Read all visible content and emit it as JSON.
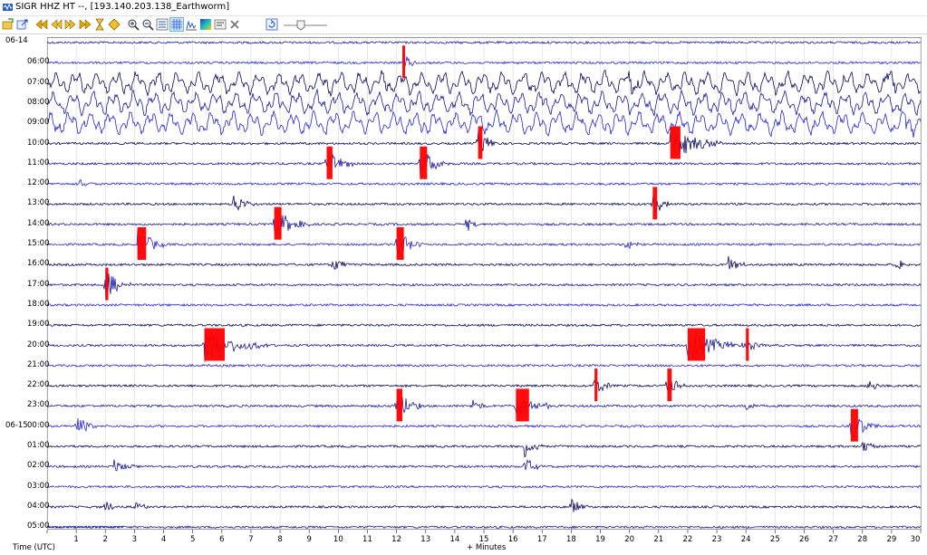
{
  "window": {
    "title": "SIGR HHZ HT --, [193.140.203.138_Earthworm]"
  },
  "toolbar": {
    "icons": [
      "open-file-icon",
      "rewind-icon",
      "step-back-icon",
      "step-forward-icon",
      "fast-forward-icon",
      "hourglass-icon",
      "event-marker-icon",
      "zoom-in-icon",
      "zoom-out-icon",
      "filter-icon",
      "grid-view-icon",
      "spectrum-icon",
      "color-scale-icon",
      "settings-icon",
      "close-icon",
      "refresh-icon",
      "zoom-slider"
    ]
  },
  "helicorder": {
    "row_labels": [
      {
        "date": "06-14",
        "time": ""
      },
      {
        "date": "",
        "time": "06:00"
      },
      {
        "date": "",
        "time": "07:00"
      },
      {
        "date": "",
        "time": "08:00"
      },
      {
        "date": "",
        "time": "09:00"
      },
      {
        "date": "",
        "time": "10:00"
      },
      {
        "date": "",
        "time": "11:00"
      },
      {
        "date": "",
        "time": "12:00"
      },
      {
        "date": "",
        "time": "13:00"
      },
      {
        "date": "",
        "time": "14:00"
      },
      {
        "date": "",
        "time": "15:00"
      },
      {
        "date": "",
        "time": "16:00"
      },
      {
        "date": "",
        "time": "17:00"
      },
      {
        "date": "",
        "time": "18:00"
      },
      {
        "date": "",
        "time": "19:00"
      },
      {
        "date": "",
        "time": "20:00"
      },
      {
        "date": "",
        "time": "21:00"
      },
      {
        "date": "",
        "time": "22:00"
      },
      {
        "date": "",
        "time": "23:00"
      },
      {
        "date": "06-15",
        "time": "00:00"
      },
      {
        "date": "",
        "time": "01:00"
      },
      {
        "date": "",
        "time": "02:00"
      },
      {
        "date": "",
        "time": "03:00"
      },
      {
        "date": "",
        "time": "04:00"
      },
      {
        "date": "",
        "time": "05:00"
      }
    ],
    "x_ticks": [
      "1",
      "2",
      "3",
      "4",
      "5",
      "6",
      "7",
      "8",
      "9",
      "10",
      "11",
      "12",
      "13",
      "14",
      "15",
      "16",
      "17",
      "18",
      "19",
      "20",
      "21",
      "22",
      "23",
      "24",
      "25",
      "26",
      "27",
      "28",
      "29",
      "30"
    ],
    "x_axis_label": "+ Minutes",
    "y_axis_label": "Time (UTC)",
    "x_range": [
      0,
      30
    ],
    "trace_colors": [
      "#1a1a9c",
      "#2626d6",
      "#0a0a5c"
    ],
    "event_color": "#ff0000",
    "gridline_color": "#d8d8d8",
    "events": [
      {
        "row": 5,
        "minute": 14.8,
        "amp": 16,
        "dur": 0.8,
        "mark": 0.15
      },
      {
        "row": 5,
        "minute": 21.4,
        "amp": 20,
        "dur": 1.8,
        "mark": 0.35
      },
      {
        "row": 6,
        "minute": 9.6,
        "amp": 18,
        "dur": 0.9,
        "mark": 0.2
      },
      {
        "row": 6,
        "minute": 12.8,
        "amp": 18,
        "dur": 1.0,
        "mark": 0.25
      },
      {
        "row": 7,
        "minute": 1.1,
        "amp": 7,
        "dur": 0.5,
        "mark": 0
      },
      {
        "row": 8,
        "minute": 6.4,
        "amp": 12,
        "dur": 0.8,
        "mark": 0
      },
      {
        "row": 8,
        "minute": 20.8,
        "amp": 16,
        "dur": 0.6,
        "mark": 0.15
      },
      {
        "row": 9,
        "minute": 7.8,
        "amp": 18,
        "dur": 1.2,
        "mark": 0.25
      },
      {
        "row": 9,
        "minute": 14.4,
        "amp": 10,
        "dur": 0.4,
        "mark": 0
      },
      {
        "row": 10,
        "minute": 3.1,
        "amp": 18,
        "dur": 1.0,
        "mark": 0.3
      },
      {
        "row": 10,
        "minute": 12.0,
        "amp": 18,
        "dur": 0.9,
        "mark": 0.25
      },
      {
        "row": 10,
        "minute": 19.9,
        "amp": 8,
        "dur": 0.5,
        "mark": 0
      },
      {
        "row": 11,
        "minute": 9.8,
        "amp": 10,
        "dur": 0.6,
        "mark": 0
      },
      {
        "row": 11,
        "minute": 23.4,
        "amp": 10,
        "dur": 0.6,
        "mark": 0
      },
      {
        "row": 11,
        "minute": 29.2,
        "amp": 8,
        "dur": 0.5,
        "mark": 0
      },
      {
        "row": 12,
        "minute": 2.0,
        "amp": 18,
        "dur": 0.9,
        "mark": 0.1
      },
      {
        "row": 15,
        "minute": 5.4,
        "amp": 18,
        "dur": 2.2,
        "mark": 0.7
      },
      {
        "row": 15,
        "minute": 22.0,
        "amp": 18,
        "dur": 2.0,
        "mark": 0.6
      },
      {
        "row": 15,
        "minute": 24.0,
        "amp": 12,
        "dur": 0.6,
        "mark": 0.1
      },
      {
        "row": 17,
        "minute": 18.8,
        "amp": 14,
        "dur": 0.6,
        "mark": 0.1
      },
      {
        "row": 17,
        "minute": 21.3,
        "amp": 14,
        "dur": 0.6,
        "mark": 0.15
      },
      {
        "row": 17,
        "minute": 28.2,
        "amp": 8,
        "dur": 0.6,
        "mark": 0
      },
      {
        "row": 18,
        "minute": 12.0,
        "amp": 18,
        "dur": 0.9,
        "mark": 0.2
      },
      {
        "row": 18,
        "minute": 16.1,
        "amp": 18,
        "dur": 1.2,
        "mark": 0.45
      },
      {
        "row": 18,
        "minute": 24.0,
        "amp": 8,
        "dur": 0.5,
        "mark": 0
      },
      {
        "row": 18,
        "minute": 14.6,
        "amp": 10,
        "dur": 0.5,
        "mark": 0
      },
      {
        "row": 19,
        "minute": 1.0,
        "amp": 12,
        "dur": 0.8,
        "mark": 0
      },
      {
        "row": 19,
        "minute": 27.6,
        "amp": 18,
        "dur": 1.0,
        "mark": 0.25
      },
      {
        "row": 20,
        "minute": 16.4,
        "amp": 14,
        "dur": 0.6,
        "mark": 0
      },
      {
        "row": 20,
        "minute": 28.0,
        "amp": 8,
        "dur": 0.6,
        "mark": 0
      },
      {
        "row": 21,
        "minute": 2.3,
        "amp": 10,
        "dur": 0.7,
        "mark": 0
      },
      {
        "row": 21,
        "minute": 16.4,
        "amp": 12,
        "dur": 0.6,
        "mark": 0
      },
      {
        "row": 23,
        "minute": 2.0,
        "amp": 8,
        "dur": 0.5,
        "mark": 0
      },
      {
        "row": 23,
        "minute": 3.0,
        "amp": 8,
        "dur": 0.5,
        "mark": 0
      },
      {
        "row": 23,
        "minute": 18.0,
        "amp": 10,
        "dur": 0.6,
        "mark": 0
      },
      {
        "row": 1,
        "minute": 12.2,
        "amp": 12,
        "dur": 0.6,
        "mark": 0.05
      },
      {
        "row": 2,
        "minute": 20.0,
        "amp": 10,
        "dur": 0.6,
        "mark": 0
      },
      {
        "row": 2,
        "minute": 28.8,
        "amp": 12,
        "dur": 0.6,
        "mark": 0
      },
      {
        "row": 3,
        "minute": 9.3,
        "amp": 8,
        "dur": 0.5,
        "mark": 0
      },
      {
        "row": 4,
        "minute": 29.4,
        "amp": 10,
        "dur": 0.5,
        "mark": 0
      }
    ],
    "noisy_rows": [
      2,
      3,
      4
    ]
  }
}
